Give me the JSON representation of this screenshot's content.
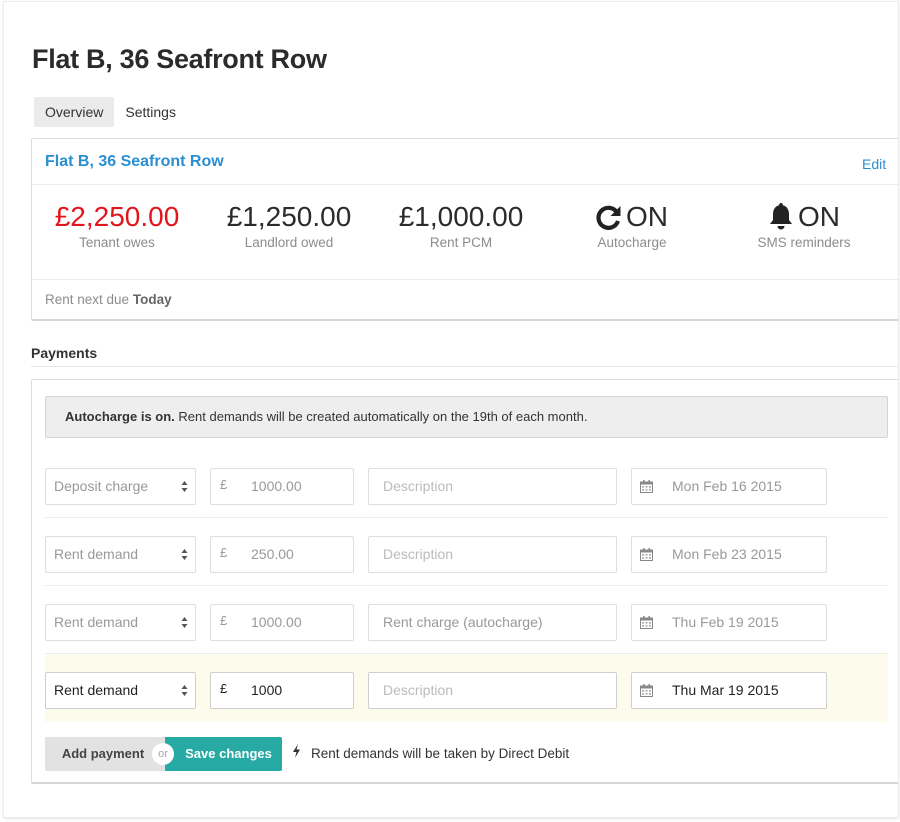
{
  "page": {
    "title": "Flat B, 36 Seafront Row"
  },
  "tabs": [
    {
      "label": "Overview",
      "active": true
    },
    {
      "label": "Settings",
      "active": false
    }
  ],
  "summary": {
    "title": "Flat B, 36 Seafront Row",
    "edit_label": "Edit",
    "stats": [
      {
        "value": "£2,250.00",
        "label": "Tenant owes",
        "color": "#e3151c"
      },
      {
        "value": "£1,250.00",
        "label": "Landlord owed"
      },
      {
        "value": "£1,000.00",
        "label": "Rent PCM"
      },
      {
        "value": "ON",
        "label": "Autocharge",
        "icon": "refresh-icon"
      },
      {
        "value": "ON",
        "label": "SMS reminders",
        "icon": "bell-icon"
      }
    ],
    "due_prefix": "Rent next due",
    "due_value": "Today"
  },
  "payments": {
    "section_title": "Payments",
    "alert_bold": "Autocharge is on.",
    "alert_text": " Rent demands will be created automatically on the 19th of each month.",
    "currency_symbol": "£",
    "rows": [
      {
        "type": "Deposit charge",
        "amount": "1000.00",
        "description": "",
        "description_placeholder": "Description",
        "date": "Mon Feb 16 2015"
      },
      {
        "type": "Rent demand",
        "amount": "250.00",
        "description": "",
        "description_placeholder": "Description",
        "date": "Mon Feb 23 2015"
      },
      {
        "type": "Rent demand",
        "amount": "1000.00",
        "description": "Rent charge (autocharge)",
        "description_placeholder": "Description",
        "date": "Thu Feb 19 2015"
      },
      {
        "type": "Rent demand",
        "amount": "1000",
        "description": "",
        "description_placeholder": "Description",
        "date": "Thu Mar 19 2015",
        "highlighted": true
      }
    ],
    "add_label": "Add payment",
    "or_label": "or",
    "save_label": "Save changes",
    "direct_debit_note": "Rent demands will be taken by Direct Debit",
    "accent_color": "#27a9a4"
  }
}
